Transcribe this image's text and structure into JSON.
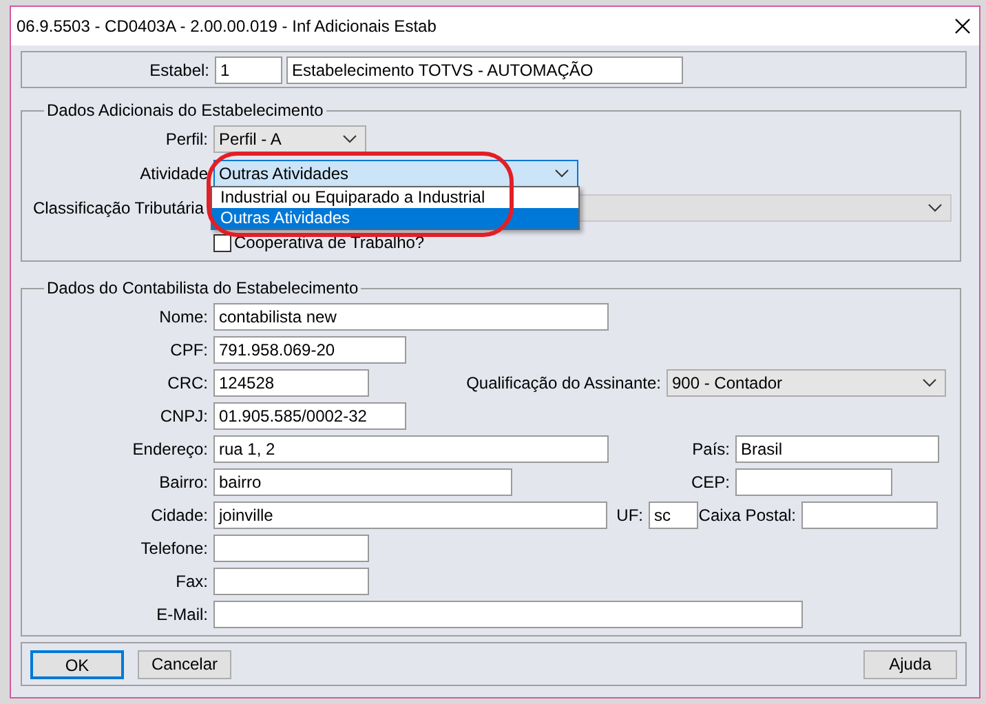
{
  "window": {
    "title": "06.9.5503 - CD0403A - 2.00.00.019 - Inf Adicionais Estab"
  },
  "estabel": {
    "label": "Estabel:",
    "code": "1",
    "name": "Estabelecimento TOTVS - AUTOMAÇÃO"
  },
  "dados_adicionais": {
    "title": "Dados Adicionais do Estabelecimento",
    "perfil": {
      "label": "Perfil:",
      "value": "Perfil - A"
    },
    "atividade": {
      "label": "Atividade",
      "value": "Outras Atividades",
      "expanded": true,
      "options": [
        {
          "label": "Industrial ou Equiparado a Industrial",
          "selected": false
        },
        {
          "label": "Outras Atividades",
          "selected": true
        }
      ]
    },
    "classificacao": {
      "label": "Classificação Tributária",
      "disabled": true
    },
    "cooperativa": {
      "label": "Cooperativa de Trabalho?",
      "checked": false
    }
  },
  "contabilista": {
    "title": "Dados do Contabilista do Estabelecimento",
    "fields": [
      {
        "kind": "text",
        "label": "Nome:",
        "value": "contabilista new"
      },
      {
        "kind": "text",
        "label": "CPF:",
        "value": "791.958.069-20"
      },
      {
        "kind": "text",
        "label": "CRC:",
        "value": "124528"
      },
      {
        "kind": "select",
        "label": "Qualificação do Assinante:",
        "value": "900 - Contador"
      },
      {
        "kind": "text",
        "label": "CNPJ:",
        "value": "01.905.585/0002-32"
      },
      {
        "kind": "text",
        "label": "Endereço:",
        "value": "rua 1, 2"
      },
      {
        "kind": "text",
        "label": "País:",
        "value": "Brasil"
      },
      {
        "kind": "text",
        "label": "Bairro:",
        "value": "bairro"
      },
      {
        "kind": "text",
        "label": "CEP:"
      },
      {
        "kind": "text",
        "label": "Cidade:",
        "value": "joinville"
      },
      {
        "kind": "text",
        "label": "UF:",
        "value": "sc"
      },
      {
        "kind": "text",
        "label": "Caixa Postal:"
      },
      {
        "kind": "text",
        "label": "Telefone:"
      },
      {
        "kind": "text",
        "label": "Fax:"
      },
      {
        "kind": "text",
        "label": "E-Mail:"
      }
    ]
  },
  "buttons": [
    {
      "label": "OK",
      "default": true
    },
    {
      "label": "Cancelar",
      "default": false
    },
    {
      "label": "Ajuda",
      "default": false
    }
  ]
}
